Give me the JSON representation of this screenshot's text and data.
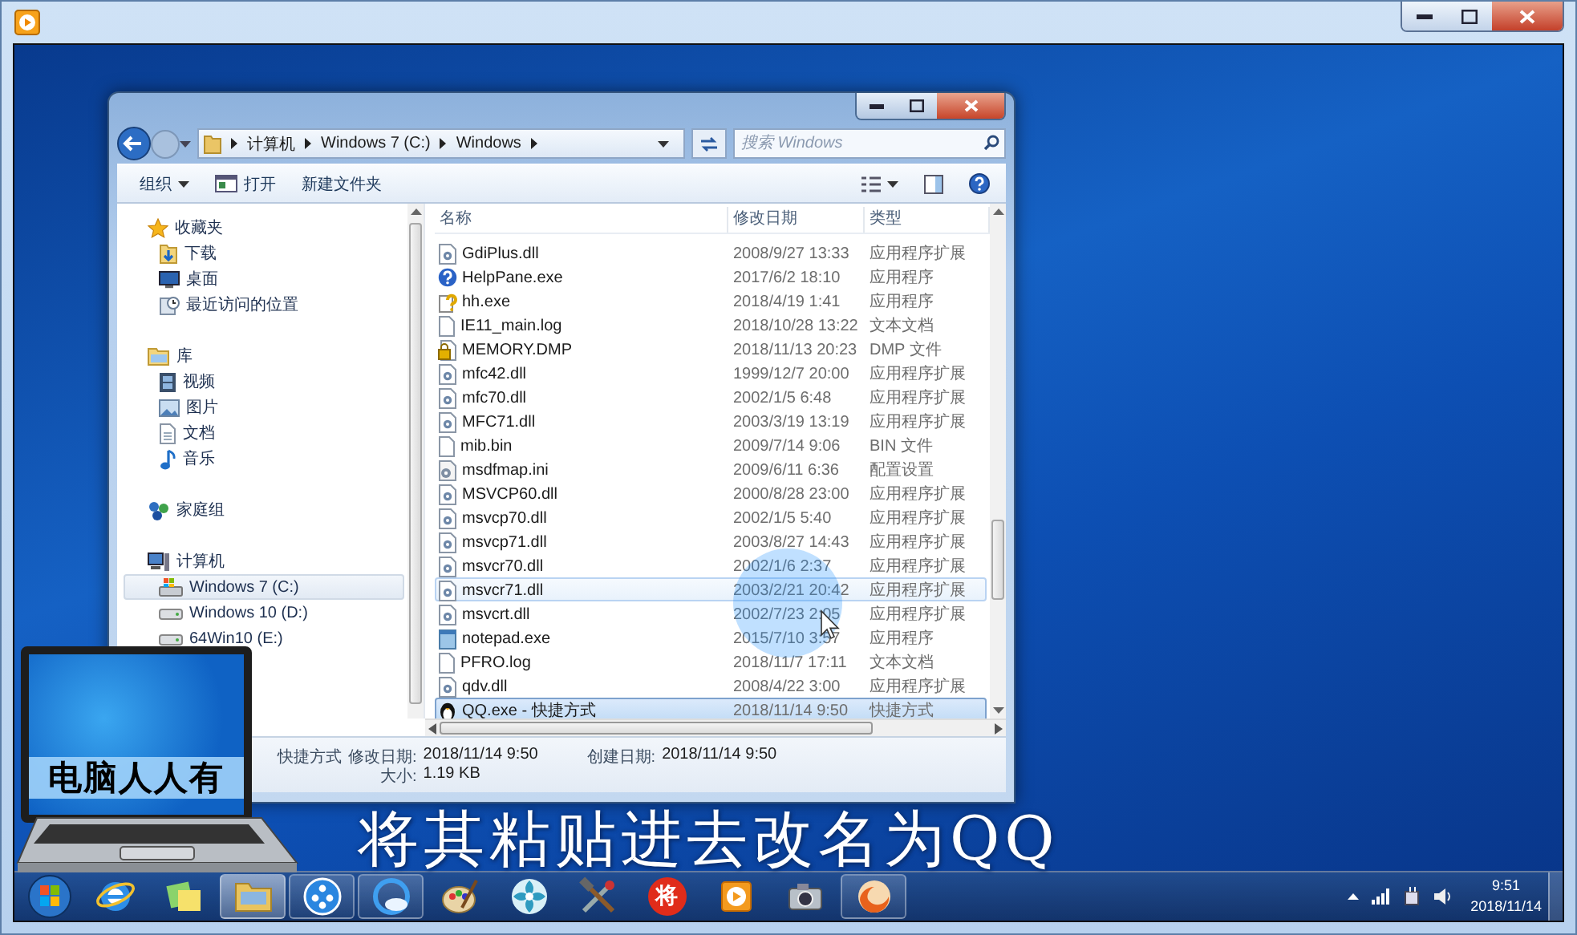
{
  "explorer": {
    "address": {
      "segments": [
        "计算机",
        "Windows 7 (C:)",
        "Windows"
      ]
    },
    "search": {
      "placeholder": "搜索 Windows"
    },
    "toolbar": [
      {
        "label": "组织",
        "kind": "menu"
      },
      {
        "label": "打开",
        "kind": "open"
      },
      {
        "label": "新建文件夹",
        "kind": "plain"
      }
    ],
    "nav": [
      {
        "label": "收藏夹",
        "kind": "favorites",
        "selected": false,
        "children": [
          {
            "label": "下载",
            "kind": "downloads",
            "selected": false
          },
          {
            "label": "桌面",
            "kind": "desktop",
            "selected": false
          },
          {
            "label": "最近访问的位置",
            "kind": "recent",
            "selected": false
          }
        ]
      },
      {
        "label": "库",
        "kind": "libraries",
        "selected": false,
        "children": [
          {
            "label": "视频",
            "kind": "video",
            "selected": false
          },
          {
            "label": "图片",
            "kind": "pictures",
            "selected": false
          },
          {
            "label": "文档",
            "kind": "documents",
            "selected": false
          },
          {
            "label": "音乐",
            "kind": "music",
            "selected": false
          }
        ]
      },
      {
        "label": "家庭组",
        "kind": "homegroup",
        "selected": false
      },
      {
        "label": "计算机",
        "kind": "computer",
        "selected": false,
        "children": [
          {
            "label": "Windows 7 (C:)",
            "kind": "system-drive",
            "selected": true
          },
          {
            "label": "Windows 10 (D:)",
            "kind": "drive",
            "selected": false
          },
          {
            "label": "64Win10 (E:)",
            "kind": "drive",
            "selected": false
          }
        ]
      }
    ],
    "columns": [
      "名称",
      "修改日期",
      "类型"
    ],
    "files": [
      {
        "name": "GdiPlus.dll",
        "date": "2008/9/27 13:33",
        "type": "应用程序扩展",
        "kind": "dll",
        "selected": false,
        "hovered": false
      },
      {
        "name": "HelpPane.exe",
        "date": "2017/6/2 18:10",
        "type": "应用程序",
        "kind": "help",
        "selected": false,
        "hovered": false
      },
      {
        "name": "hh.exe",
        "date": "2018/4/19 1:41",
        "type": "应用程序",
        "kind": "helpdoc",
        "selected": false,
        "hovered": false
      },
      {
        "name": "IE11_main.log",
        "date": "2018/10/28 13:22",
        "type": "文本文档",
        "kind": "text",
        "selected": false,
        "hovered": false
      },
      {
        "name": "MEMORY.DMP",
        "date": "2018/11/13 20:23",
        "type": "DMP 文件",
        "kind": "locked",
        "selected": false,
        "hovered": false
      },
      {
        "name": "mfc42.dll",
        "date": "1999/12/7 20:00",
        "type": "应用程序扩展",
        "kind": "dll",
        "selected": false,
        "hovered": false
      },
      {
        "name": "mfc70.dll",
        "date": "2002/1/5 6:48",
        "type": "应用程序扩展",
        "kind": "dll",
        "selected": false,
        "hovered": false
      },
      {
        "name": "MFC71.dll",
        "date": "2003/3/19 13:19",
        "type": "应用程序扩展",
        "kind": "dll",
        "selected": false,
        "hovered": false
      },
      {
        "name": "mib.bin",
        "date": "2009/7/14 9:06",
        "type": "BIN 文件",
        "kind": "text",
        "selected": false,
        "hovered": false
      },
      {
        "name": "msdfmap.ini",
        "date": "2009/6/11 6:36",
        "type": "配置设置",
        "kind": "ini",
        "selected": false,
        "hovered": false
      },
      {
        "name": "MSVCP60.dll",
        "date": "2000/8/28 23:00",
        "type": "应用程序扩展",
        "kind": "dll",
        "selected": false,
        "hovered": false
      },
      {
        "name": "msvcp70.dll",
        "date": "2002/1/5 5:40",
        "type": "应用程序扩展",
        "kind": "dll",
        "selected": false,
        "hovered": false
      },
      {
        "name": "msvcp71.dll",
        "date": "2003/8/27 14:43",
        "type": "应用程序扩展",
        "kind": "dll",
        "selected": false,
        "hovered": false
      },
      {
        "name": "msvcr70.dll",
        "date": "2002/1/6 2:37",
        "type": "应用程序扩展",
        "kind": "dll",
        "selected": false,
        "hovered": false
      },
      {
        "name": "msvcr71.dll",
        "date": "2003/2/21 20:42",
        "type": "应用程序扩展",
        "kind": "dll",
        "selected": false,
        "hovered": true
      },
      {
        "name": "msvcrt.dll",
        "date": "2002/7/23 2:05",
        "type": "应用程序扩展",
        "kind": "dll",
        "selected": false,
        "hovered": false
      },
      {
        "name": "notepad.exe",
        "date": "2015/7/10 3:57",
        "type": "应用程序",
        "kind": "notepad",
        "selected": false,
        "hovered": false
      },
      {
        "name": "PFRO.log",
        "date": "2018/11/7 17:11",
        "type": "文本文档",
        "kind": "text",
        "selected": false,
        "hovered": false
      },
      {
        "name": "qdv.dll",
        "date": "2008/4/22 3:00",
        "type": "应用程序扩展",
        "kind": "dll",
        "selected": false,
        "hovered": false
      },
      {
        "name": "QQ.exe - 快捷方式",
        "date": "2018/11/14 9:50",
        "type": "快捷方式",
        "kind": "penguin",
        "selected": true,
        "hovered": false
      }
    ],
    "details": {
      "type": "快捷方式",
      "modified_label": "修改日期:",
      "modified": "2018/11/14 9:50",
      "created_label": "创建日期:",
      "created": "2018/11/14 9:50",
      "size_label": "大小:",
      "size": "1.19 KB"
    }
  },
  "caption": "将其粘贴进去改名为QQ",
  "logo": {
    "text": "电脑人人有"
  },
  "taskbar": {
    "apps": [
      {
        "kind": "browser",
        "running": false,
        "active": false
      },
      {
        "kind": "notes",
        "running": false,
        "active": false
      },
      {
        "kind": "folder",
        "running": true,
        "active": true
      },
      {
        "kind": "film-reel",
        "running": true,
        "active": false
      },
      {
        "kind": "cloud",
        "running": true,
        "active": false
      },
      {
        "kind": "palette",
        "running": false,
        "active": false
      },
      {
        "kind": "flower",
        "running": false,
        "active": false
      },
      {
        "kind": "tools",
        "running": false,
        "active": false
      },
      {
        "kind": "glyph",
        "glyph": "将",
        "running": false,
        "active": false
      },
      {
        "kind": "player",
        "running": false,
        "active": false
      },
      {
        "kind": "camera",
        "running": false,
        "active": false
      },
      {
        "kind": "fox",
        "running": true,
        "active": false
      }
    ],
    "time": "9:51",
    "date": "2018/11/14"
  }
}
